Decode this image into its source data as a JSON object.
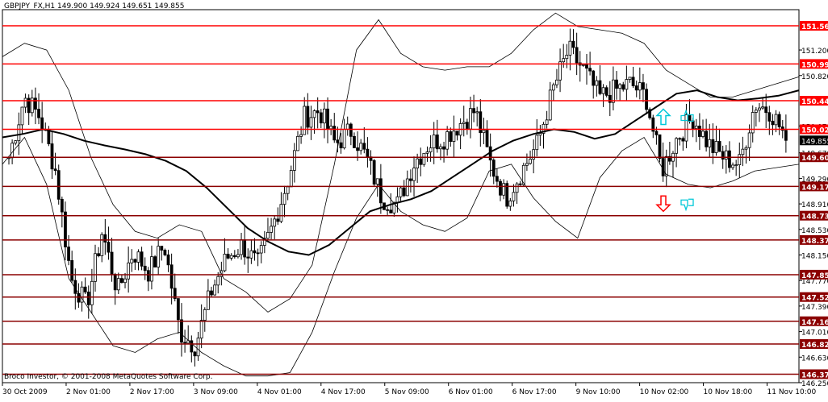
{
  "header": {
    "symbol": "GBPJPY_FX,H1",
    "ohlc": "149.900 149.924 149.651 149.855"
  },
  "copyright": "Broco Investor, © 2001-2008 MetaQuotes Software Corp.",
  "colors": {
    "background": "#ffffff",
    "price": "#000000",
    "level_red": "#ff0000",
    "level_dark": "#8b0000",
    "arrow_up": "#00c8d8",
    "arrow_down": "#ff0000",
    "hand": "#00c8d8"
  },
  "chart_data": {
    "type": "candlestick",
    "ylim": [
      146.25,
      151.8
    ],
    "y_ticks": [
      "151.200",
      "150.820",
      "150.070",
      "149.670",
      "149.290",
      "148.910",
      "148.530",
      "148.150",
      "147.770",
      "147.390",
      "147.010",
      "146.630",
      "146.250"
    ],
    "x_ticks": [
      "30 Oct 2009",
      "2 Nov 01:00",
      "2 Nov 17:00",
      "3 Nov 09:00",
      "4 Nov 01:00",
      "4 Nov 17:00",
      "5 Nov 09:00",
      "6 Nov 01:00",
      "6 Nov 17:00",
      "9 Nov 10:00",
      "10 Nov 02:00",
      "10 Nov 18:00",
      "11 Nov 10:00"
    ],
    "current_price": "149.855",
    "levels": [
      {
        "value": 151.56,
        "label": "151.560",
        "color": "#ff0000"
      },
      {
        "value": 150.992,
        "label": "150.992",
        "color": "#ff0000"
      },
      {
        "value": 150.445,
        "label": "150.445",
        "color": "#ff0000"
      },
      {
        "value": 150.02,
        "label": "150.020",
        "color": "#ff0000"
      },
      {
        "value": 149.604,
        "label": "149.604",
        "color": "#8b0000"
      },
      {
        "value": 149.17,
        "label": "149.170",
        "color": "#8b0000"
      },
      {
        "value": 148.735,
        "label": "148.735",
        "color": "#8b0000"
      },
      {
        "value": 148.373,
        "label": "148.373",
        "color": "#8b0000"
      },
      {
        "value": 147.857,
        "label": "147.857",
        "color": "#8b0000"
      },
      {
        "value": 147.524,
        "label": "147.524",
        "color": "#8b0000"
      },
      {
        "value": 147.164,
        "label": "147.164",
        "color": "#8b0000"
      },
      {
        "value": 146.825,
        "label": "146.825",
        "color": "#8b0000"
      },
      {
        "value": 146.376,
        "label": "146.376",
        "color": "#8b0000"
      }
    ],
    "ma_slow": [
      149.9,
      149.95,
      150.02,
      149.95,
      149.85,
      149.78,
      149.72,
      149.65,
      149.55,
      149.4,
      149.15,
      148.85,
      148.55,
      148.35,
      148.2,
      148.15,
      148.3,
      148.55,
      148.8,
      148.9,
      148.98,
      149.1,
      149.3,
      149.5,
      149.7,
      149.85,
      149.95,
      150.02,
      149.98,
      149.88,
      149.95,
      150.15,
      150.35,
      150.55,
      150.6,
      150.5,
      150.45,
      150.48,
      150.52,
      150.6
    ],
    "bb_upper": [
      151.1,
      151.3,
      151.2,
      150.6,
      149.6,
      148.9,
      148.5,
      148.4,
      148.6,
      148.5,
      147.8,
      147.6,
      147.3,
      147.5,
      148.0,
      149.5,
      151.2,
      151.65,
      151.15,
      150.95,
      150.9,
      150.95,
      150.95,
      151.15,
      151.5,
      151.75,
      151.55,
      151.5,
      151.45,
      151.3,
      150.9,
      150.7,
      150.5,
      150.5,
      150.6,
      150.7,
      150.8
    ],
    "bb_lower": [
      149.5,
      149.9,
      149.2,
      147.8,
      147.3,
      146.8,
      146.7,
      146.9,
      147.0,
      146.7,
      146.5,
      146.35,
      146.35,
      146.4,
      147.0,
      147.9,
      148.7,
      149.2,
      148.8,
      148.6,
      148.5,
      148.7,
      149.4,
      149.5,
      149.0,
      148.65,
      148.4,
      149.3,
      149.7,
      149.9,
      149.35,
      149.2,
      149.15,
      149.25,
      149.4,
      149.45,
      149.5
    ]
  },
  "signals": [
    {
      "dir": "up",
      "level": 150.2
    },
    {
      "dir": "down",
      "level": 148.92
    }
  ]
}
